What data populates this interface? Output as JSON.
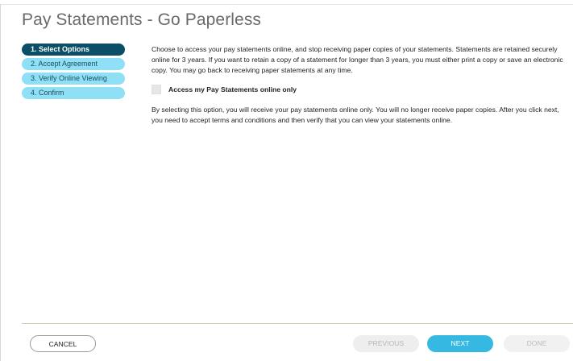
{
  "page": {
    "title": "Pay Statements - Go Paperless"
  },
  "steps": [
    {
      "label": "1. Select Options",
      "state": "active"
    },
    {
      "label": "2. Accept Agreement",
      "state": "inactive"
    },
    {
      "label": "3. Verify Online Viewing",
      "state": "inactive"
    },
    {
      "label": "4. Confirm",
      "state": "inactive"
    }
  ],
  "content": {
    "intro_lines": [
      "Choose to access your pay statements online, and stop receiving paper copies of your statements. Statements are retained securely",
      "online for 3 years. If you want to retain a copy of a statement for longer than 3 years, you must either print a copy or save an electronic",
      "copy. You may go back to receiving paper statements at any time."
    ],
    "option_label": "Access my Pay Statements online only",
    "option_checked": false,
    "detail_lines": [
      "By selecting this option, you will receive your pay statements online only. You will no longer receive paper copies. After you click next,",
      "you need to accept terms and conditions and then verify that you can view your statements online."
    ]
  },
  "footer": {
    "cancel_label": "CANCEL",
    "previous_label": "PREVIOUS",
    "next_label": "NEXT",
    "done_label": "DONE"
  },
  "colors": {
    "step_active": "#0b4e66",
    "step_inactive": "#8fe0f6",
    "primary_button": "#35b9e3"
  }
}
